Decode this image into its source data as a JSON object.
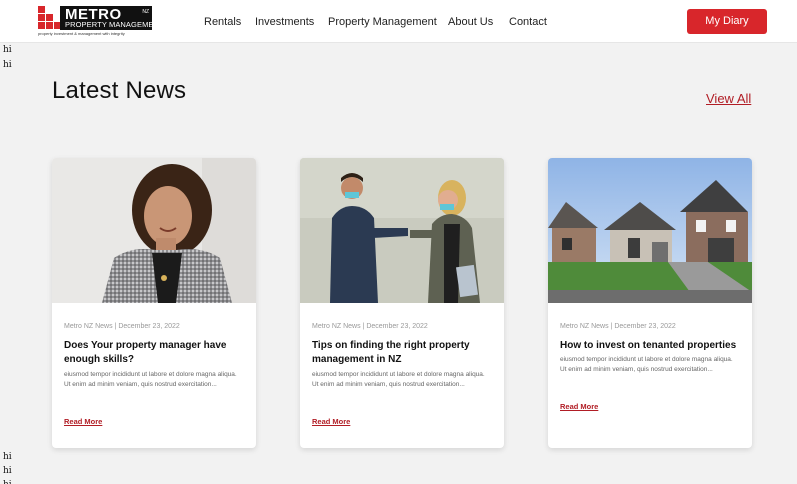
{
  "header": {
    "logo": {
      "brand": "METRO",
      "brand_sub": "PROPERTY MANAGEMENT",
      "nz": "NZ",
      "tagline": "property investment & management with integrity"
    },
    "nav": [
      "Rentals",
      "Investments",
      "Property Management",
      "About Us",
      "Contact"
    ],
    "cta_label": "My Diary"
  },
  "debug_text": [
    "hi",
    "hi",
    "hi",
    "hi",
    "hi"
  ],
  "section": {
    "title": "Latest News",
    "view_all_label": "View All"
  },
  "cards": [
    {
      "meta": "Metro NZ News | December 23, 2022",
      "title": "Does Your property manager have enough skills?",
      "excerpt": "eiusmod tempor incididunt ut labore et dolore magna aliqua. Ut enim ad minim veniam, quis nostrud exercitation...",
      "link": "Read More",
      "image": "woman-smiling-photo"
    },
    {
      "meta": "Metro NZ News | December 23, 2022",
      "title": "Tips on finding the right property management in NZ",
      "excerpt": "eiusmod tempor incididunt ut labore et dolore magna aliqua. Ut enim ad minim veniam, quis nostrud exercitation...",
      "link": "Read More",
      "image": "elbow-bump-photo"
    },
    {
      "meta": "Metro NZ News | December 23, 2022",
      "title": "How to invest on tenanted properties",
      "excerpt": "eiusmod tempor incididunt ut labore et dolore magna aliqua. Ut enim ad minim veniam, quis nostrud exercitation...",
      "link": "Read More",
      "image": "suburban-houses-photo"
    }
  ],
  "colors": {
    "accent": "#d8262b",
    "link": "#b11d25",
    "background": "#f2f2f2"
  }
}
